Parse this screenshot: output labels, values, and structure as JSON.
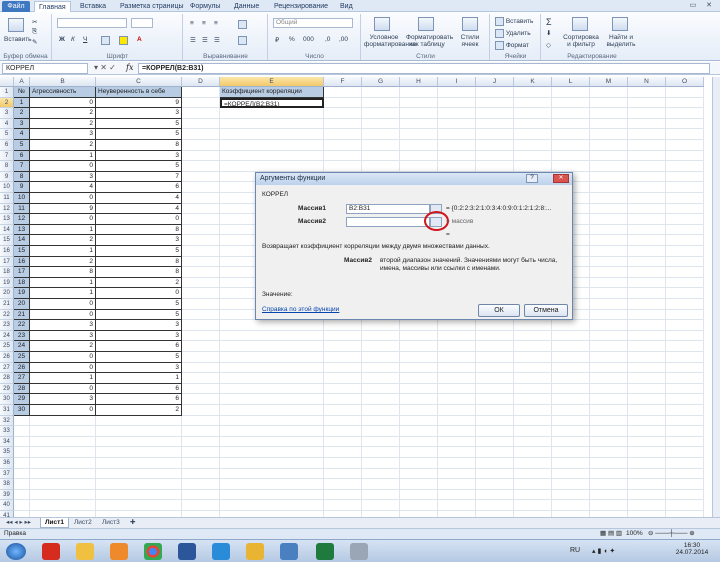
{
  "ribbon": {
    "tabs": [
      "Файл",
      "Главная",
      "Вставка",
      "Разметка страницы",
      "Формулы",
      "Данные",
      "Рецензирование",
      "Вид"
    ],
    "groups": {
      "clipboard": "Буфер обмена",
      "font": "Шрифт",
      "alignment": "Выравнивание",
      "number": "Число",
      "styles": "Стили",
      "cells": "Ячейки",
      "editing": "Редактирование"
    },
    "buttons": {
      "paste": "Вставить",
      "number_format": "Общий",
      "conditional": "Условное форматирование",
      "format_table": "Форматировать как таблицу",
      "cell_styles": "Стили ячеек",
      "insert": "Вставить",
      "delete": "Удалить",
      "format": "Формат",
      "sort": "Сортировка и фильтр",
      "find": "Найти и выделить"
    }
  },
  "formula_bar": {
    "name_box": "КОРРЕЛ",
    "formula": "=КОРРЕЛ(B2:B31)"
  },
  "grid": {
    "columns": [
      "A",
      "B",
      "C",
      "D",
      "E",
      "F",
      "G",
      "H",
      "I",
      "J",
      "K",
      "L",
      "M",
      "N",
      "O"
    ],
    "headers": {
      "A1": "№",
      "B1": "Агрессивность",
      "C1": "Неуверенность в себе",
      "E1": "Коэффициент корреляции",
      "E2": "=КОРРЕЛ(B2:B31)"
    },
    "rows": [
      [
        1,
        0,
        9
      ],
      [
        2,
        2,
        3
      ],
      [
        3,
        2,
        5
      ],
      [
        4,
        3,
        5
      ],
      [
        5,
        2,
        8
      ],
      [
        6,
        1,
        3
      ],
      [
        7,
        0,
        5
      ],
      [
        8,
        3,
        7
      ],
      [
        9,
        4,
        6
      ],
      [
        10,
        0,
        4
      ],
      [
        11,
        9,
        4
      ],
      [
        12,
        0,
        0
      ],
      [
        13,
        1,
        8
      ],
      [
        14,
        2,
        3
      ],
      [
        15,
        1,
        5
      ],
      [
        16,
        2,
        8
      ],
      [
        17,
        8,
        8
      ],
      [
        18,
        1,
        2
      ],
      [
        19,
        1,
        0
      ],
      [
        20,
        0,
        5
      ],
      [
        21,
        0,
        5
      ],
      [
        22,
        3,
        3
      ],
      [
        23,
        3,
        3
      ],
      [
        24,
        2,
        6
      ],
      [
        25,
        0,
        5
      ],
      [
        26,
        0,
        3
      ],
      [
        27,
        1,
        1
      ],
      [
        28,
        0,
        6
      ],
      [
        29,
        3,
        6
      ],
      [
        30,
        0,
        2
      ]
    ]
  },
  "sheets": [
    "Лист1",
    "Лист2",
    "Лист3"
  ],
  "status": {
    "mode": "Правка",
    "zoom": "100%"
  },
  "taskbar": {
    "lang": "RU",
    "time": "16:30",
    "date": "24.07.2014"
  },
  "dialog": {
    "title": "Аргументы функции",
    "function": "КОРРЕЛ",
    "arg1_label": "Массив1",
    "arg1_value": "B2:B31",
    "arg1_result": "= {0:2:2:3:2:1:0:3:4:0:9:0:1:2:1:2:8:...",
    "arg2_label": "Массив2",
    "arg2_value": "",
    "arg2_result": "= массив",
    "equals": "=",
    "description": "Возвращает коэффициент корреляции между двумя множествами данных.",
    "arg2_help_label": "Массив2",
    "arg2_help": "второй диапазон значений. Значениями могут быть числа, имена, массивы или ссылки с именами.",
    "value_label": "Значение:",
    "help_link": "Справка по этой функции",
    "ok": "ОК",
    "cancel": "Отмена"
  }
}
